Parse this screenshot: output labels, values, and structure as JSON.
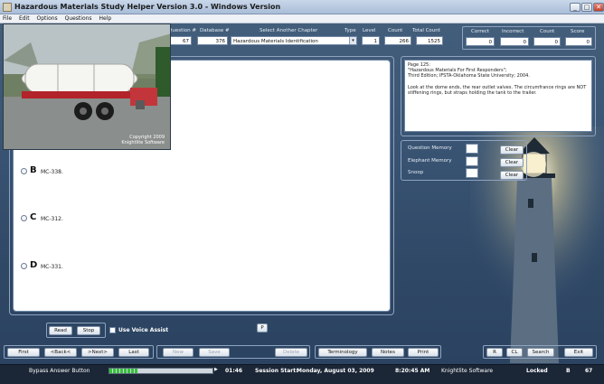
{
  "window": {
    "title": "Hazardous Materials Study Helper Version 3.0 - Windows Version",
    "minimize": "_",
    "maximize": "□",
    "close": "✕"
  },
  "menu": [
    "File",
    "Edit",
    "Options",
    "Questions",
    "Help"
  ],
  "header": {
    "question_label": "Question #",
    "question_value": "67",
    "database_label": "Database #",
    "database_value": "376",
    "chapter_label": "Select Another Chapter",
    "chapter_value": "Hazardous Materials Identification",
    "type_label": "Type",
    "level_label": "Level",
    "level_value": "1",
    "count_label": "Count",
    "count_value": "266",
    "total_label": "Total Count",
    "total_value": "1525"
  },
  "score": {
    "correct_label": "Correct",
    "correct_value": "0",
    "incorrect_label": "Incorrect",
    "incorrect_value": "0",
    "count_label": "Count",
    "count_value": "0",
    "score_label": "Score",
    "score_value": "0"
  },
  "photo": {
    "caption_line1": "Copyright 2009",
    "caption_line2": "Knightlite Software"
  },
  "options": [
    {
      "letter": "B",
      "text": "MC-338."
    },
    {
      "letter": "C",
      "text": "MC-312."
    },
    {
      "letter": "D",
      "text": "MC-331."
    }
  ],
  "reference": {
    "line1": "Page 125:",
    "line2": "\"Hazardous Materials For First Responders\";",
    "line3": "Third Edition; IFSTA-Oklahoma State University; 2004.",
    "line4": "Look at the dome ends, the rear outlet valves. The circumfrance rings are NOT",
    "line5": "stiffening rings, but straps holding the tank to the trailer."
  },
  "memory": {
    "question_label": "Question Memory",
    "elephant_label": "Elephant Memory",
    "snoop_label": "Snoop",
    "clear": "Clear"
  },
  "controls": {
    "read": "Read",
    "stop": "Stop",
    "voice_assist": "Use Voice Assist",
    "p": "P",
    "first": "First",
    "back": "<Back<",
    "next": ">Next>",
    "last": "Last",
    "new": "New",
    "save": "Save",
    "delete": "Delete",
    "terminology": "Terminology",
    "notes": "Notes",
    "print": "Print",
    "r": "R",
    "cl": "CL",
    "search": "Search",
    "exit": "Exit"
  },
  "status": {
    "bypass": "Bypass Answer Button",
    "progress_fraction": 0.27,
    "timer": "01:46",
    "session_label": "Session Start:",
    "session_date": "Monday, August 03, 2009",
    "time": "8:20:45 AM",
    "company": "Knightlite Software",
    "locked": "Locked",
    "b": "B",
    "num": "67"
  }
}
